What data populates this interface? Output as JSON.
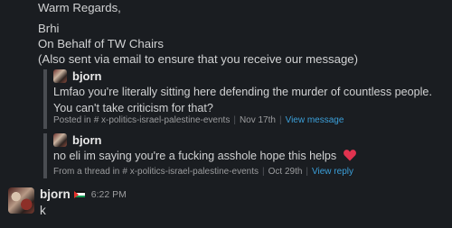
{
  "letter": {
    "closing": "Warm Regards,",
    "signer": "Brhi",
    "on_behalf": "On Behalf of TW Chairs",
    "note": "(Also sent via email to ensure that you receive our message)"
  },
  "quotes": [
    {
      "author": "bjorn",
      "text": "Lmfao you're literally sitting here defending the murder of countless people. You can't take criticism for that?",
      "meta_prefix": "Posted in",
      "channel": "# x-politics-israel-palestine-events",
      "date": "Nov 17th",
      "action": "View message"
    },
    {
      "author": "bjorn",
      "text": "no eli im saying you're a fucking asshole hope this helps",
      "emoji": "heart-emoji",
      "meta_prefix": "From a thread in",
      "channel": "# x-politics-israel-palestine-events",
      "date": "Oct 29th",
      "action": "View reply"
    }
  ],
  "message": {
    "author": "bjorn",
    "status_emoji": "palestine-flag-icon",
    "time": "6:22 PM",
    "text": "k"
  },
  "colors": {
    "background": "#1a1d21",
    "text": "#d1d2d3",
    "link": "#3b9fd9",
    "quote_bar": "#4a4d52",
    "heart": "#e0334f"
  }
}
